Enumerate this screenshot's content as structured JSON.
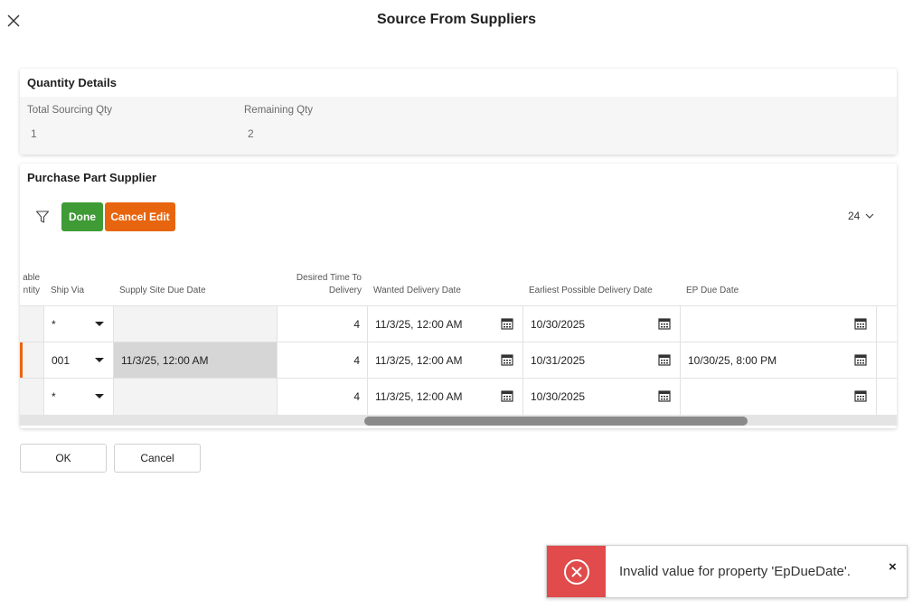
{
  "dialog": {
    "title": "Source From Suppliers"
  },
  "quantity_details": {
    "title": "Quantity Details",
    "fields": [
      {
        "label": "Total Sourcing Qty",
        "value": "1"
      },
      {
        "label": "Remaining Qty",
        "value": "2"
      }
    ]
  },
  "purchase_part_supplier": {
    "title": "Purchase Part Supplier",
    "toolbar": {
      "done_label": "Done",
      "cancel_edit_label": "Cancel Edit",
      "page_size": "24"
    },
    "columns": {
      "partial_col_line1": "able",
      "partial_col_line2": "ntity",
      "ship_via": "Ship Via",
      "supply_site_due_date": "Supply Site Due Date",
      "desired_time_line1": "Desired Time To",
      "desired_time_line2": "Delivery",
      "wanted_delivery_date": "Wanted Delivery Date",
      "earliest_possible_delivery_date": "Earliest Possible Delivery Date",
      "ep_due_date": "EP Due Date"
    },
    "rows": [
      {
        "ship_via": "*",
        "supply_site_due_date": "",
        "desired_time": "4",
        "wanted_delivery_date": "11/3/25, 12:00 AM",
        "earliest_possible_delivery_date": "10/30/2025",
        "ep_due_date": "",
        "editing": false
      },
      {
        "ship_via": "001",
        "supply_site_due_date": "11/3/25, 12:00 AM",
        "desired_time": "4",
        "wanted_delivery_date": "11/3/25, 12:00 AM",
        "earliest_possible_delivery_date": "10/31/2025",
        "ep_due_date": "10/30/25, 8:00 PM",
        "editing": true
      },
      {
        "ship_via": "*",
        "supply_site_due_date": "",
        "desired_time": "4",
        "wanted_delivery_date": "11/3/25, 12:00 AM",
        "earliest_possible_delivery_date": "10/30/2025",
        "ep_due_date": "",
        "editing": false
      }
    ]
  },
  "footer": {
    "ok_label": "OK",
    "cancel_label": "Cancel"
  },
  "toast": {
    "message": "Invalid value for property 'EpDueDate'.",
    "close_label": "×"
  },
  "colors": {
    "done": "#3f9b35",
    "cancel_edit": "#e8650f",
    "error": "#e14b4b",
    "edit_marker": "#e8650f"
  }
}
